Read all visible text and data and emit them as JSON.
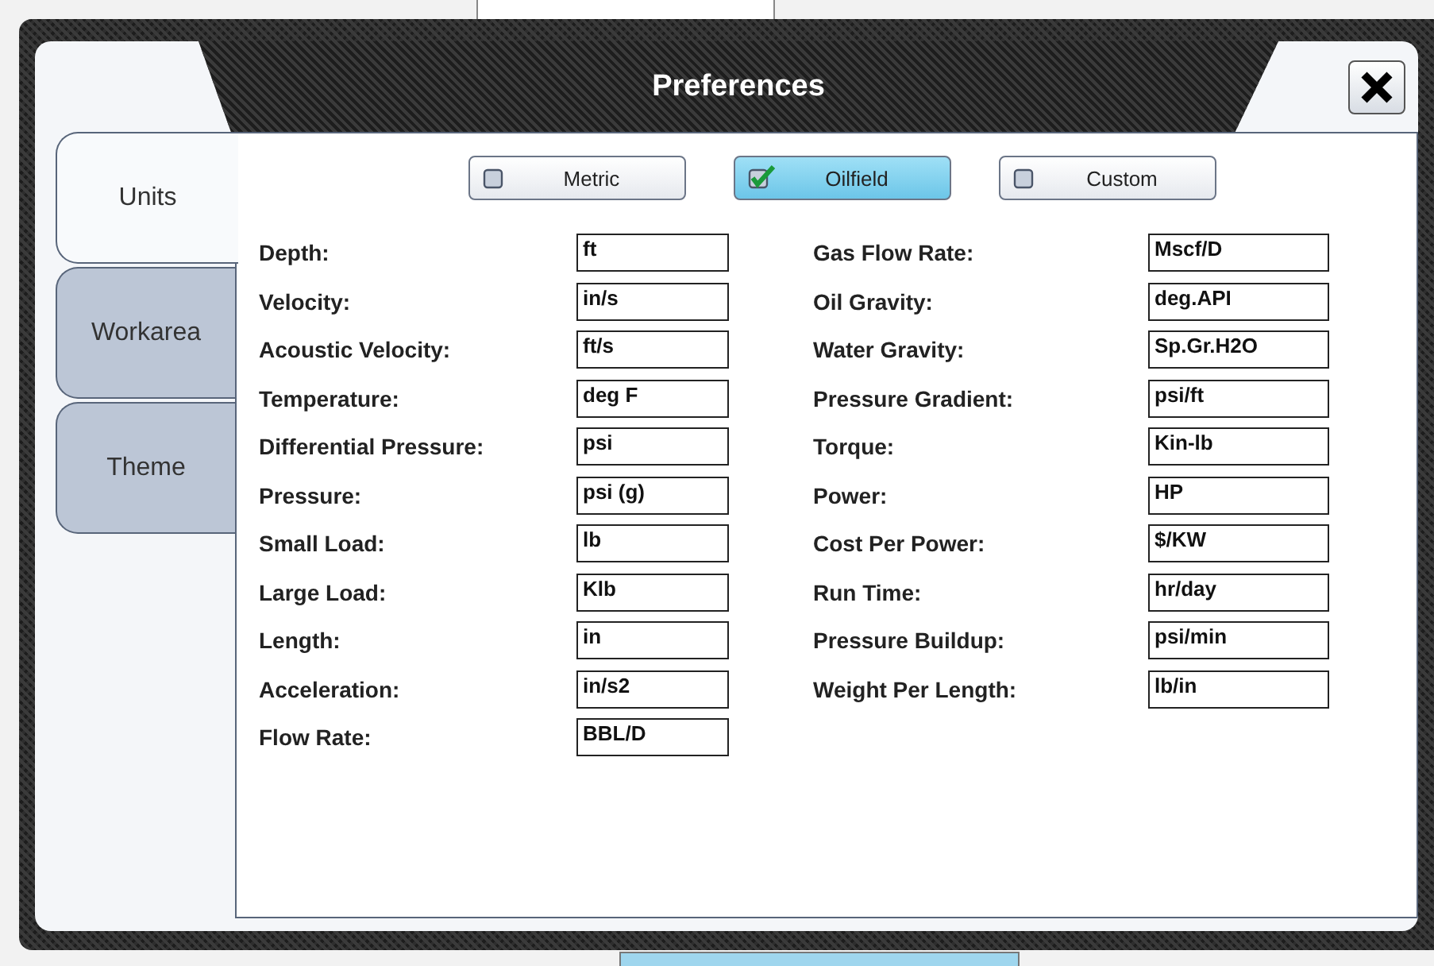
{
  "window": {
    "title": "Preferences"
  },
  "tabs": [
    {
      "label": "Units",
      "selected": true
    },
    {
      "label": "Workarea",
      "selected": false
    },
    {
      "label": "Theme",
      "selected": false
    }
  ],
  "unit_systems": [
    {
      "label": "Metric",
      "selected": false
    },
    {
      "label": "Oilfield",
      "selected": true
    },
    {
      "label": "Custom",
      "selected": false
    }
  ],
  "left_units": [
    {
      "label": "Depth:",
      "value": "ft"
    },
    {
      "label": "Velocity:",
      "value": "in/s"
    },
    {
      "label": "Acoustic Velocity:",
      "value": "ft/s"
    },
    {
      "label": "Temperature:",
      "value": "deg F"
    },
    {
      "label": "Differential Pressure:",
      "value": "psi"
    },
    {
      "label": "Pressure:",
      "value": "psi (g)"
    },
    {
      "label": "Small Load:",
      "value": "lb"
    },
    {
      "label": "Large Load:",
      "value": "Klb"
    },
    {
      "label": "Length:",
      "value": "in"
    },
    {
      "label": "Acceleration:",
      "value": "in/s2"
    },
    {
      "label": "Flow Rate:",
      "value": "BBL/D"
    }
  ],
  "right_units": [
    {
      "label": "Gas Flow Rate:",
      "value": "Mscf/D"
    },
    {
      "label": "Oil Gravity:",
      "value": "deg.API"
    },
    {
      "label": "Water Gravity:",
      "value": "Sp.Gr.H2O"
    },
    {
      "label": "Pressure Gradient:",
      "value": "psi/ft"
    },
    {
      "label": "Torque:",
      "value": "Kin-lb"
    },
    {
      "label": "Power:",
      "value": "HP"
    },
    {
      "label": "Cost Per Power:",
      "value": "$/KW"
    },
    {
      "label": "Run Time:",
      "value": "hr/day"
    },
    {
      "label": "Pressure Buildup:",
      "value": "psi/min"
    },
    {
      "label": "Weight Per Length:",
      "value": "lb/in"
    }
  ]
}
